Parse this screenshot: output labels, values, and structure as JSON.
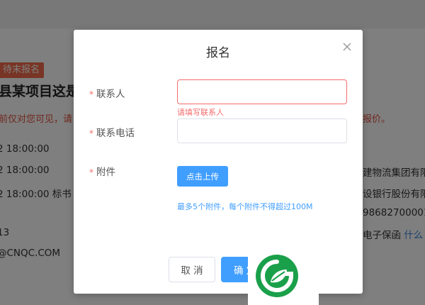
{
  "background": {
    "status_tag": "待末报名",
    "project_title": "县某项目这是",
    "warning_left": "前仅对您可见，请",
    "warning_right": "报价。",
    "rows": [
      {
        "left": "2 18:00:00",
        "right": ""
      },
      {
        "left": "2 18:00:00",
        "right": "建物流集团有限"
      },
      {
        "left": "2 18:00:00   标书",
        "right": "设银行股份有限"
      },
      {
        "left": "",
        "right": "98682700001"
      },
      {
        "left": "13",
        "right": "电子保函",
        "right_link": "什么"
      },
      {
        "left": "@CNQC.COM",
        "right": ""
      }
    ]
  },
  "dialog": {
    "title": "报名",
    "contact_label": "联系人",
    "contact_value": "",
    "contact_error": "请填写联系人",
    "phone_label": "联系电话",
    "phone_value": "",
    "attachment_label": "附件",
    "upload_label": "点击上传",
    "upload_tip": "最多5个附件，每个附件不得超过100M",
    "cancel_label": "取 消",
    "confirm_label": "确 定",
    "required_mark": "*"
  },
  "colors": {
    "primary": "#409eff",
    "error": "#f56c6c",
    "status_tag": "#f06a4a",
    "logo_green": "#1aa04a"
  },
  "icons": {
    "close": "close-icon",
    "watermark": "leaf-logo-icon"
  }
}
